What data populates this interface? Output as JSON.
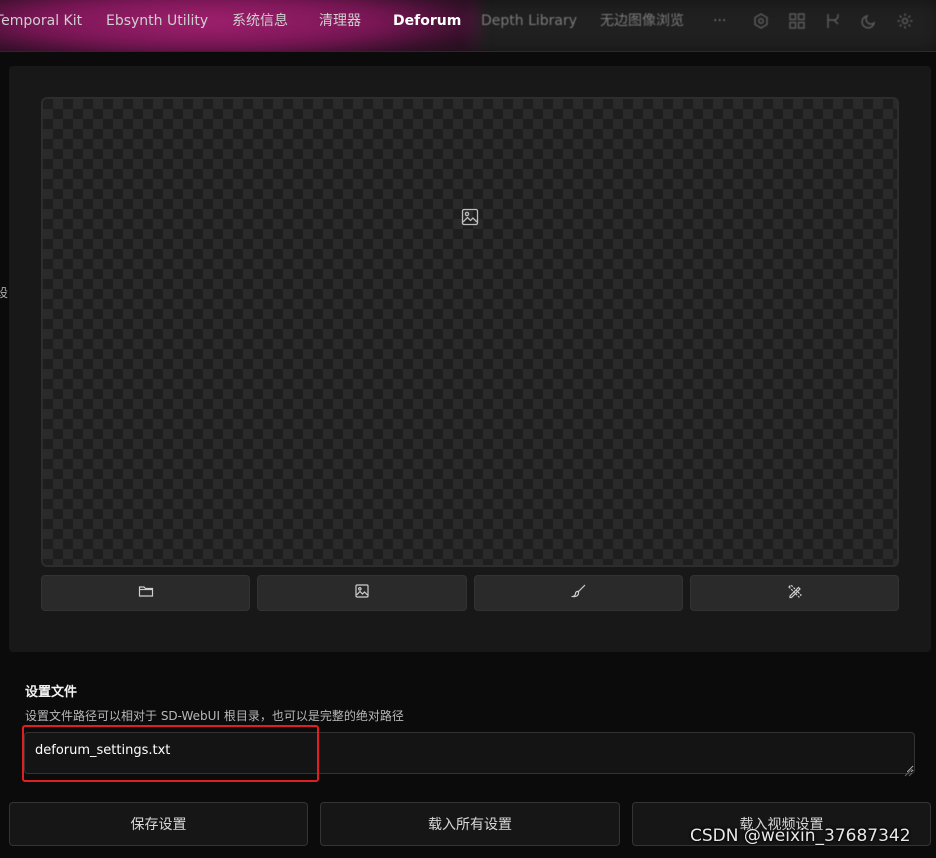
{
  "tabs": [
    {
      "label": "Temporal Kit"
    },
    {
      "label": "Ebsynth Utility"
    },
    {
      "label": "系统信息"
    },
    {
      "label": "清理器"
    },
    {
      "label": "Deforum"
    },
    {
      "label": "Depth Library"
    },
    {
      "label": "无边图像浏览"
    },
    {
      "label": "···"
    }
  ],
  "active_tab": "Deforum",
  "side_clip_text": "设",
  "settings_file": {
    "label": "设置文件",
    "hint": "设置文件路径可以相对于 SD-WebUI 根目录，也可以是完整的绝对路径",
    "value": "deforum_settings.txt"
  },
  "buttons": {
    "save": "保存设置",
    "load_all": "载入所有设置",
    "load_video": "载入视频设置"
  },
  "watermark": "CSDN @weixin_37687342",
  "colors": {
    "accent_glow": "#a0206e",
    "highlight_box": "#e02020"
  }
}
